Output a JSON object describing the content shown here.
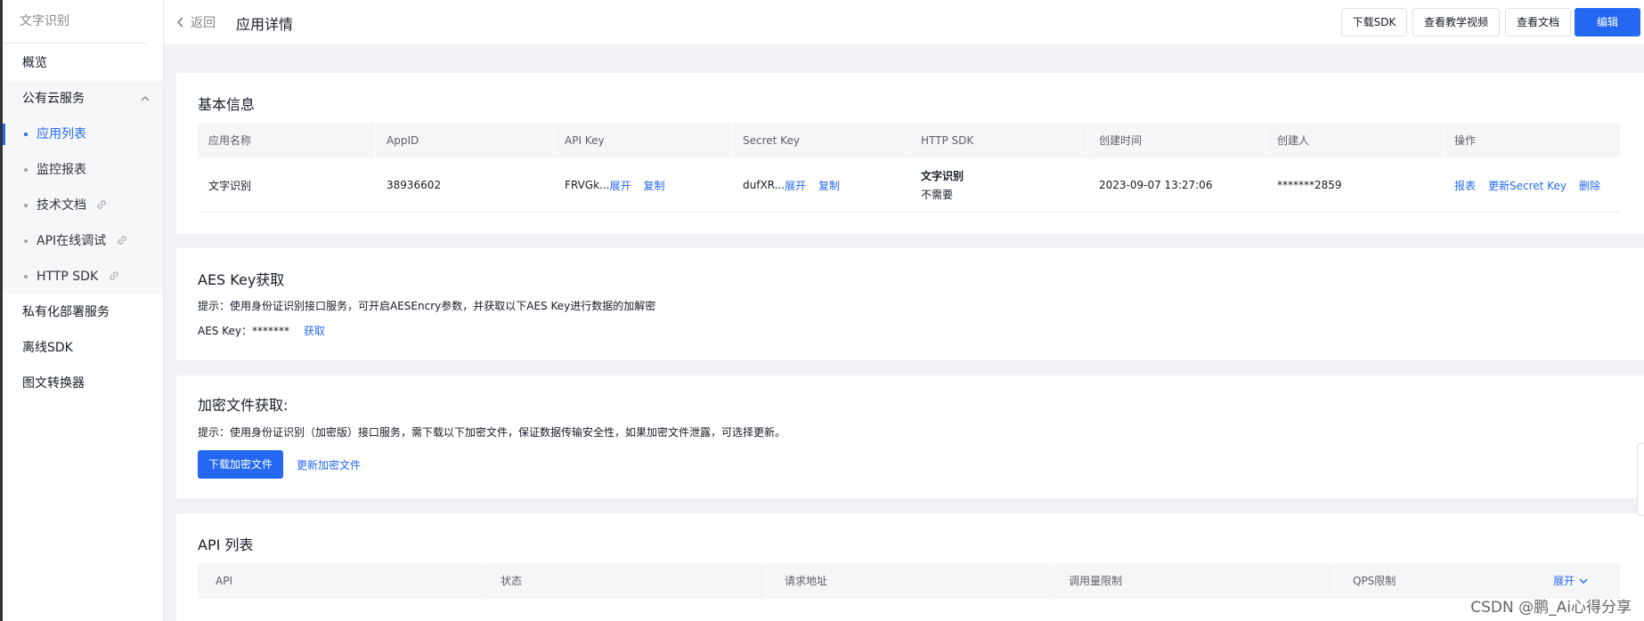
{
  "sidebar": {
    "title": "文字识别",
    "items": [
      {
        "label": "概览"
      },
      {
        "label": "公有云服务"
      },
      {
        "label": "应用列表"
      },
      {
        "label": "监控报表"
      },
      {
        "label": "技术文档"
      },
      {
        "label": "API在线调试"
      },
      {
        "label": "HTTP SDK"
      },
      {
        "label": "私有化部署服务"
      },
      {
        "label": "离线SDK"
      },
      {
        "label": "图文转换器"
      }
    ]
  },
  "header": {
    "back": "返回",
    "title": "应用详情",
    "buttons": {
      "download_sdk": "下载SDK",
      "tutorial": "查看教学视频",
      "docs": "查看文档",
      "edit": "编辑"
    }
  },
  "basic": {
    "title": "基本信息",
    "columns": [
      "应用名称",
      "AppID",
      "API Key",
      "Secret Key",
      "HTTP SDK",
      "创建时间",
      "创建人",
      "操作"
    ],
    "row": {
      "name": "文字识别",
      "appid": "38936602",
      "api_key": "FRVGk...",
      "secret_key": "dufXR...",
      "expand": "展开",
      "copy": "复制",
      "sdk_name": "文字识别",
      "sdk_status": "不需要",
      "created": "2023-09-07 13:27:06",
      "creator": "*******2859",
      "actions": {
        "report": "报表",
        "update_secret": "更新Secret Key",
        "delete": "删除"
      }
    }
  },
  "aes": {
    "title": "AES Key获取",
    "tip": "提示：使用身份证识别接口服务，可开启AESEncry参数，并获取以下AES Key进行数据的加解密",
    "key_label": "AES Key：*******",
    "fetch": "获取"
  },
  "encrypt": {
    "title": "加密文件获取:",
    "tip": "提示：使用身份证识别（加密版）接口服务，需下载以下加密文件，保证数据传输安全性，如果加密文件泄露，可选择更新。",
    "download": "下载加密文件",
    "update": "更新加密文件"
  },
  "api_list": {
    "title": "API 列表",
    "columns": [
      "API",
      "状态",
      "请求地址",
      "调用量限制",
      "QPS限制"
    ],
    "expand": "展开"
  },
  "watermark": "CSDN @鹏_Ai心得分享",
  "colors": {
    "accent": "#2468f2"
  }
}
